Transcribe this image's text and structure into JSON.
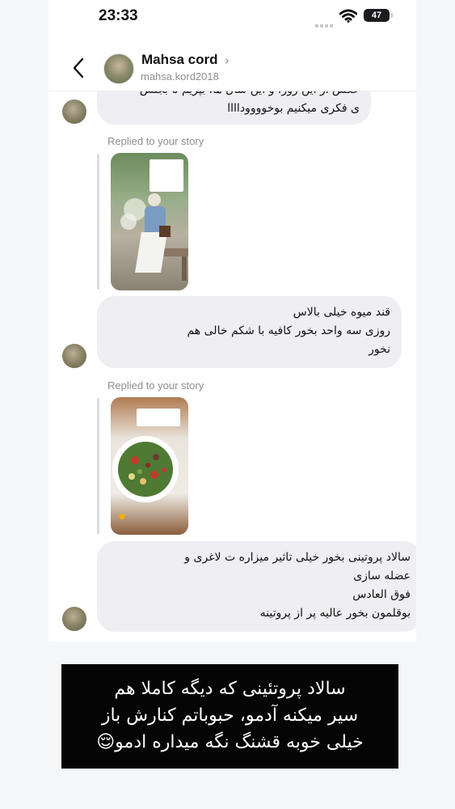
{
  "status_bar": {
    "time": "23:33",
    "battery": "47"
  },
  "header": {
    "name": "Mahsa cord",
    "handle": "mahsa.kord2018"
  },
  "messages": {
    "top_bubble": {
      "lines": [
        "عکس از این روز، و این سال ها، بپریم تا بجنس",
        "ی فکری میکنیم بوخووووداااا"
      ]
    },
    "reply1_label": "Replied to your story",
    "bubble2": {
      "lines": [
        "قند میوه خیلی بالاس",
        "روزی سه واحد بخور کافیه با شکم خالی هم",
        "نخور"
      ]
    },
    "reply2_label": "Replied to your story",
    "bubble3": {
      "lines": [
        "سالاد پروتینی بخور خیلی تاثیر میزاره ت لاغری و",
        "عضله سازی",
        "فوق العادس",
        "بوقلمون بخور عالیه پر از پروتینه"
      ]
    }
  },
  "caption": {
    "lines": [
      "سالاد پروتئینی که دیگه کاملا هم",
      "سیر میکنه آدمو، حبوباتم کنارش باز",
      "خیلی خوبه قشنگ نگه میداره ادمو😌"
    ]
  },
  "icons": [
    "back-chevron-icon",
    "wifi-icon",
    "signal-icon",
    "battery-icon"
  ]
}
